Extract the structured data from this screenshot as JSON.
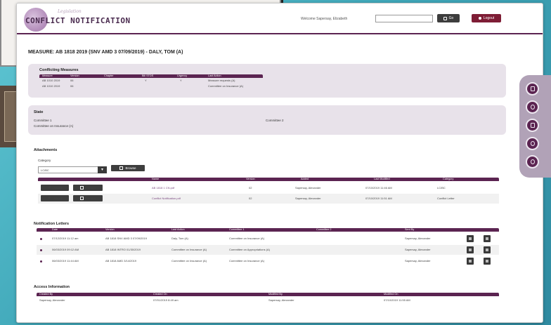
{
  "app": {
    "logo_text": "CONFLICT NOTIFICATION",
    "logo_script": "Legislation",
    "welcome": "Welcome Sapersay, Elizabeth",
    "search_placeholder": "",
    "go_label": "Go",
    "logout_label": "Logout",
    "accent": "#5b2451",
    "logout_color": "#7e1d35"
  },
  "page": {
    "title": "MEASURE: AB 1818 2019 (SNV AMD 3 07/09/2019) - DALY, TOM (A)"
  },
  "conflicting": {
    "title": "Conflicting Measures",
    "columns": [
      "Measure",
      "Version",
      "Chapter",
      "Bill STDS",
      "Urgency",
      "Last Action"
    ],
    "rows": [
      [
        "AB 1010 2019",
        "06",
        "",
        "Y",
        "Y",
        "Measure requests (A)"
      ],
      [
        "AB 1010 2019",
        "06",
        "",
        "",
        "",
        "Committee on Insurance (A)"
      ]
    ]
  },
  "state": {
    "title": "State",
    "committee1_label": "Committee 1",
    "committee1_value": "Committee on Insurance (A)",
    "committee2_label": "Committee 2"
  },
  "attachments": {
    "title": "Attachments",
    "category_label": "Category",
    "category_value": "LC/BC",
    "browse_label": "Browse",
    "columns": [
      "Name",
      "Version",
      "Added",
      "Last Modified",
      "Category"
    ],
    "rows": [
      {
        "upload": "Upload",
        "preview": "Preview",
        "name": "AB 1818 1 CN.pdf",
        "version": "02",
        "added": "Sapersay, Alexander",
        "modified": "07/10/2019 11:46 AM",
        "category": "LC/BC"
      },
      {
        "upload": "Upload",
        "preview": "Preview",
        "name": "Conflict Notification.pdf",
        "version": "02",
        "added": "Sapersay, Alexander",
        "modified": "07/10/2019 11:51 AM",
        "category": "Conflict Letter"
      }
    ]
  },
  "letters": {
    "title": "Notification Letters",
    "columns": [
      "Date",
      "Version",
      "Last Action",
      "Committee 1",
      "Committee 2",
      "Sent By"
    ],
    "rows": [
      [
        "07/12/2019 11:12 am",
        "AB 1818 SNV AMD 3 07/09/2019",
        "Daly, Tom (A)",
        "Committee on Insurance (A)",
        "",
        "Sapersay, Alexander"
      ],
      [
        "06/03/2019 09:12 AM",
        "AB 1818 INTRO 01/30/2019",
        "Committee on Insurance (A)",
        "Committee on Appropriations (A)",
        "",
        "Sapersay, Alexander"
      ],
      [
        "06/03/2019 11:44 AM",
        "AB 1818 AMD 3/14/2019",
        "Committee on Insurance (A)",
        "Committee on Insurance (A)",
        "",
        "Sapersay, Alexander"
      ]
    ]
  },
  "access": {
    "title": "Access Information",
    "columns": [
      "Created By",
      "Created On",
      "Modified By",
      "Modified On"
    ],
    "row": [
      "Sapersay, Alexander",
      "07/01/2019 8:49 am",
      "Sapersay, Alexander",
      "07/10/2019 11:55 AM"
    ]
  },
  "rail": {
    "icons": [
      "document-icon",
      "refresh-icon",
      "window-icon",
      "magnify-icon",
      "help-icon"
    ]
  }
}
